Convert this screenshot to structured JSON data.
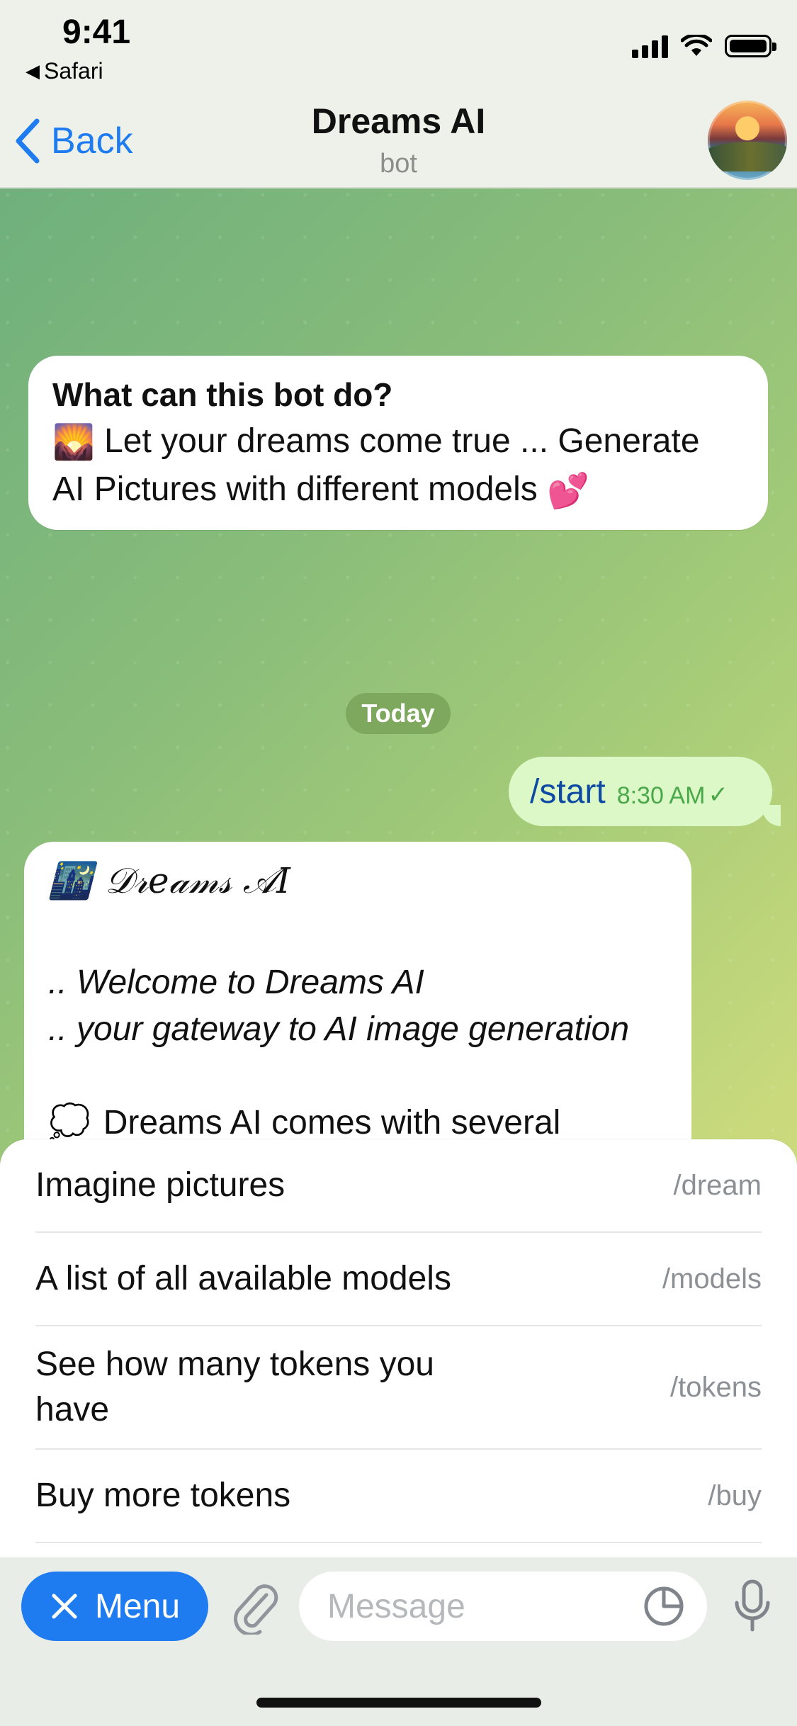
{
  "status_bar": {
    "time": "9:41",
    "back_to_app": "Safari"
  },
  "header": {
    "back_label": "Back",
    "title": "Dreams AI",
    "subtitle": "bot"
  },
  "chat": {
    "intro": {
      "title": "What can this bot do?",
      "line1": "Let your dreams come true ... Generate",
      "line2": "AI Pictures with different models",
      "emoji_start": "🌄",
      "emoji_end": "💕"
    },
    "date_separator": "Today",
    "outgoing": {
      "text": "/start",
      "time": "8:30 AM"
    },
    "welcome": {
      "title": "𝒟𝓇𝑒𝒶𝓂𝓈 𝒜𝐼",
      "title_emoji": "🌃",
      "line1": ".. Welcome to Dreams AI",
      "line2": ".. your gateway to AI image generation",
      "body": "Dreams AI comes with several",
      "body_emoji": "💭"
    }
  },
  "commands": [
    {
      "label": "Imagine pictures",
      "command": "/dream"
    },
    {
      "label": "A list of all available models",
      "command": "/models"
    },
    {
      "label_line1": "See how many tokens you",
      "label_line2": "have",
      "command": "/tokens"
    },
    {
      "label": "Buy more tokens",
      "command": "/buy"
    }
  ],
  "input_bar": {
    "menu_label": "Menu",
    "message_placeholder": "Message"
  },
  "colors": {
    "accent": "#1f7cf0",
    "outgoing_bubble": "#dcf8c7",
    "date_badge": "#7fa85f"
  }
}
